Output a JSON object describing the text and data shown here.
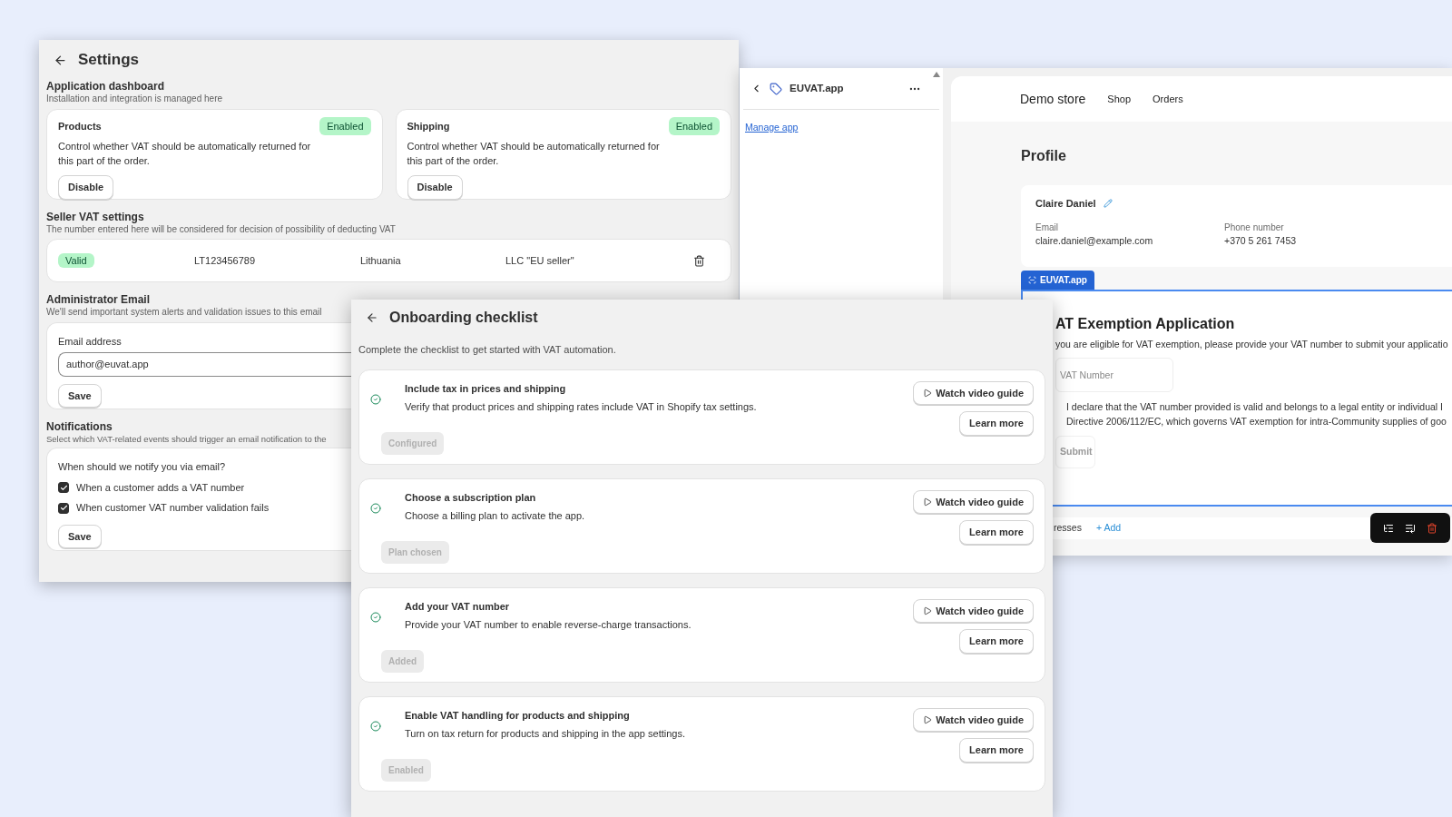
{
  "settings": {
    "title": "Settings",
    "dashboard": {
      "heading": "Application dashboard",
      "subtitle": "Installation and integration is managed here",
      "cards": [
        {
          "title": "Products",
          "status": "Enabled",
          "enabled": true,
          "description": "Control whether VAT should be automatically returned for this part of the order.",
          "button": "Disable"
        },
        {
          "title": "Shipping",
          "status": "Enabled",
          "enabled": true,
          "description": "Control whether VAT should be automatically returned for this part of the order.",
          "button": "Disable"
        }
      ]
    },
    "seller": {
      "heading": "Seller VAT settings",
      "subtitle": "The number entered here will be considered for decision of possibility of deducting VAT",
      "row": {
        "status": "Valid",
        "valid": true,
        "vat_number": "LT123456789",
        "country": "Lithuania",
        "company": "LLC \"EU seller\""
      }
    },
    "admin_email": {
      "heading": "Administrator Email",
      "subtitle": "We'll send important system alerts and validation issues to this email",
      "field_label": "Email address",
      "value": "author@euvat.app",
      "button": "Save"
    },
    "notifications": {
      "heading": "Notifications",
      "subtitle": "Select which VAT-related events should trigger an email notification to the",
      "question": "When should we notify you via email?",
      "options": [
        {
          "label": "When a customer adds a VAT number",
          "checked": true
        },
        {
          "label": "When customer VAT number validation fails",
          "checked": true
        }
      ],
      "button": "Save"
    }
  },
  "app_sidebar": {
    "title": "EUVAT.app",
    "link": "Manage app"
  },
  "storefront": {
    "store_name": "Demo store",
    "nav": [
      "Shop",
      "Orders"
    ],
    "page_title": "Profile",
    "customer": {
      "name": "Claire Daniel",
      "fields": [
        {
          "label": "Email",
          "value": "claire.daniel@example.com"
        },
        {
          "label": "Phone number",
          "value": "+370 5 261 7453"
        }
      ]
    },
    "block_tab": "EUVAT.app",
    "form": {
      "title": "AT Exemption Application",
      "intro": "you are eligible for VAT exemption, please provide your VAT number to submit your applicatio",
      "placeholder": "VAT Number",
      "declaration": [
        "I declare that the VAT number provided is valid and belongs to a legal entity or individual I",
        "Directive 2006/112/EC, which governs VAT exemption for intra-Community supplies of goo"
      ],
      "submit": "Submit",
      "submit_disabled": true
    },
    "addresses": {
      "label": "resses",
      "add": "+ Add"
    }
  },
  "onboarding": {
    "title": "Onboarding checklist",
    "subtitle": "Complete the checklist to get started with VAT automation.",
    "steps": [
      {
        "title": "Include tax in prices and shipping",
        "description": "Verify that product prices and shipping rates include VAT in Shopify tax settings.",
        "done": true,
        "status": "Configured",
        "disabled": true,
        "watch": "Watch video guide",
        "learn": "Learn more"
      },
      {
        "title": "Choose a subscription plan",
        "description": "Choose a billing plan to activate the app.",
        "done": true,
        "status": "Plan chosen",
        "disabled": true,
        "watch": "Watch video guide",
        "learn": "Learn more"
      },
      {
        "title": "Add your VAT number",
        "description": "Provide your VAT number to enable reverse-charge transactions.",
        "done": true,
        "status": "Added",
        "disabled": true,
        "watch": "Watch video guide",
        "learn": "Learn more"
      },
      {
        "title": "Enable VAT handling for products and shipping",
        "description": "Turn on tax return for products and shipping in the app settings.",
        "done": true,
        "status": "Enabled",
        "disabled": true,
        "watch": "Watch video guide",
        "learn": "Learn more"
      }
    ]
  }
}
